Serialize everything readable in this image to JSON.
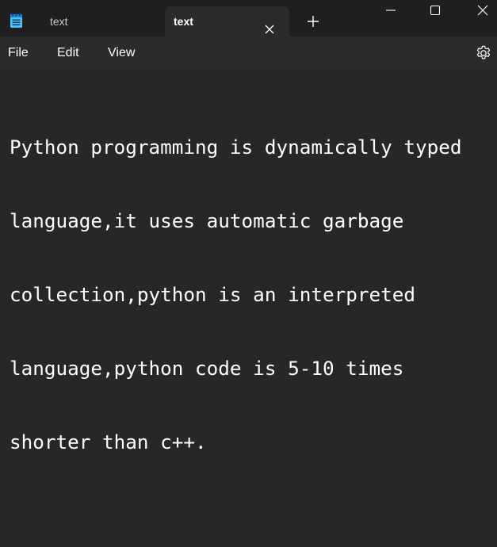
{
  "tabs": [
    {
      "label": "text",
      "active": false
    },
    {
      "label": "text",
      "active": true
    }
  ],
  "icons": {
    "app": "notepad-icon",
    "tab_close": "close-icon",
    "new_tab": "plus-icon",
    "minimize": "minimize-icon",
    "maximize": "maximize-icon",
    "close": "close-icon",
    "settings": "gear-icon"
  },
  "menu": {
    "file": "File",
    "edit": "Edit",
    "view": "View"
  },
  "editor": {
    "lines": [
      "Python programming is dynamically typed",
      "language,it uses automatic garbage",
      "collection,python is an interpreted",
      "language,python code is 5-10 times",
      "shorter than c++."
    ]
  },
  "colors": {
    "titlebar": "#1f1f1f",
    "active_tab": "#2b2b2b",
    "editor_bg": "#272727",
    "text": "#ffffff",
    "icon_accent": "#4fc3f7"
  }
}
